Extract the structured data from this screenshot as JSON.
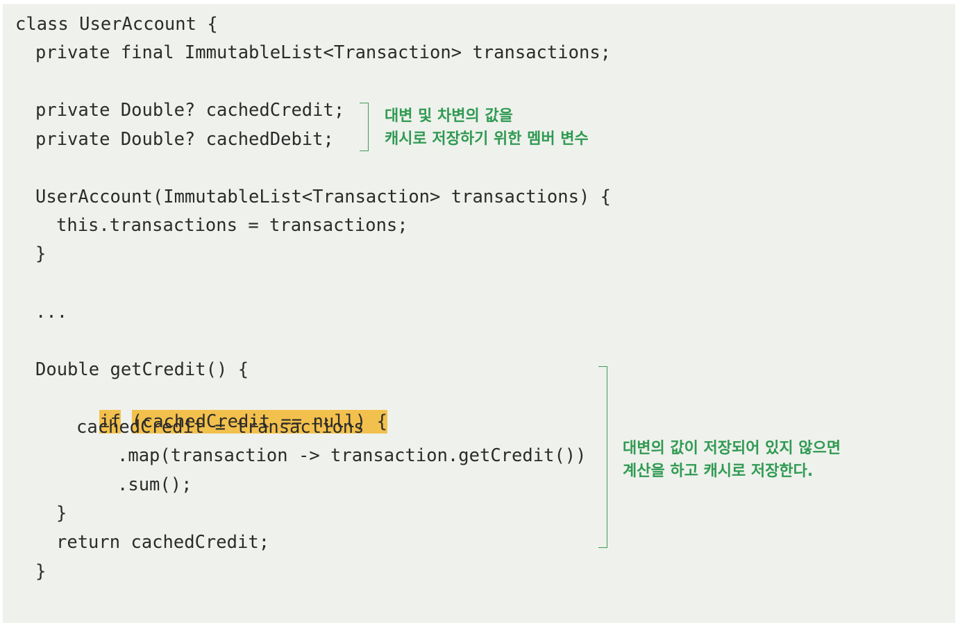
{
  "code": {
    "l1": "class UserAccount {",
    "l2": "private final ImmutableList<Transaction> transactions;",
    "l3": "private Double? cachedCredit;",
    "l4": "private Double? cachedDebit;",
    "l5": "UserAccount(ImmutableList<Transaction> transactions) {",
    "l6": "this.transactions = transactions;",
    "l7": "}",
    "l8": "...",
    "l9": "Double getCredit() {",
    "l10_if": "if",
    "l10_cond": "(cachedCredit == null) {",
    "l11": "cachedCredit = transactions",
    "l12": ".map(transaction -> transaction.getCredit())",
    "l13": ".sum();",
    "l14": "}",
    "l15": "return cachedCredit;",
    "l16": "}"
  },
  "annotations": {
    "cache_fields_line1": "대변 및 차변의 값을",
    "cache_fields_line2": "캐시로 저장하기 위한 멤버 변수",
    "get_credit_line1": "대변의 값이 저장되어 있지 않으면",
    "get_credit_line2": "계산을 하고 캐시로 저장한다."
  },
  "colors": {
    "background": "#eff1ec",
    "highlight": "#f2c04c",
    "annotation": "#2f9a52",
    "code_text": "#2b2b2b"
  }
}
